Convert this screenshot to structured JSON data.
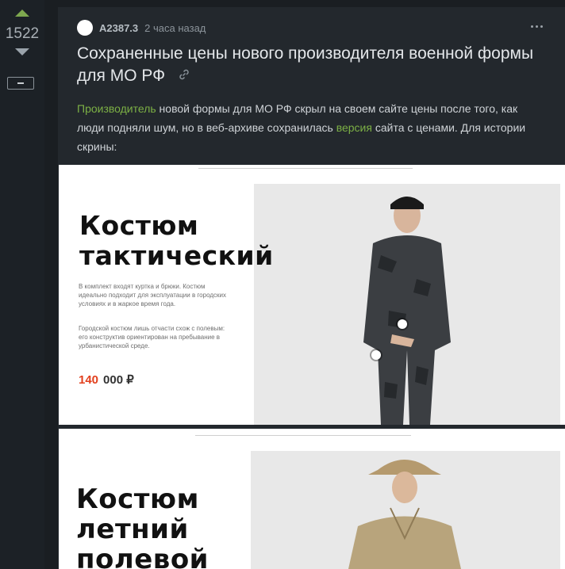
{
  "rating": {
    "score": "1522"
  },
  "post": {
    "author": "A2387.3",
    "time": "2 часа назад",
    "title": "Сохраненные цены нового производителя военной формы для МО РФ",
    "body": {
      "link1": "Производитель",
      "text1": " новой формы для МО РФ скрыл на своем сайте цены после того, как люди подняли шум, но в веб-архиве сохранилась ",
      "link2": "версия",
      "text2": " сайта с ценами. Для истории скрины:"
    }
  },
  "image1": {
    "headline_line1": "Костюм",
    "headline_line2": "тактический",
    "desc_para1": "В комплект входят куртка и брюки. Костюм идеально подходит для эксплуатации в городских условиях и в жаркое время года.",
    "desc_para2": "Городской костюм лишь отчасти схож с полевым: его конструктив ориентирован на пребывание в урбанистической среде.",
    "price_amount": "140",
    "price_rest": "000 ₽"
  },
  "image2": {
    "headline_line1": "Костюм",
    "headline_line2": "летний",
    "headline_line3": "полевой"
  },
  "icons": [
    "vote-up-icon",
    "vote-down-icon",
    "collapse-icon",
    "more-icon",
    "link-icon"
  ],
  "colors": {
    "accent": "#7ea84f",
    "link": "#7cb045",
    "price": "#e2401e",
    "background": "#1a1e22",
    "card": "#23282d"
  }
}
